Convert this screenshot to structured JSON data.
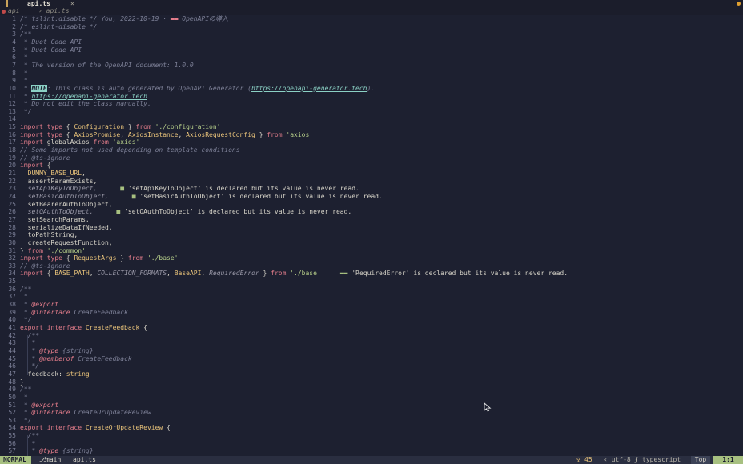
{
  "tab": {
    "label": "api.ts",
    "close": "×"
  },
  "breadcrumb": {
    "root": "api",
    "sep": "›",
    "file": "› api.ts"
  },
  "editor": {
    "lines": [
      {
        "n": "1",
        "segs": [
          [
            "cmt",
            "/* tslint:disable */ You, 2022-10-19 · "
          ],
          [
            "kw",
            "▬▬"
          ],
          [
            "cmt",
            " OpenAPIの導入"
          ]
        ]
      },
      {
        "n": "2",
        "segs": [
          [
            "cmt",
            "/* eslint-disable */"
          ]
        ]
      },
      {
        "n": "3",
        "segs": [
          [
            "cmt",
            "/**"
          ]
        ]
      },
      {
        "n": "4",
        "segs": [
          [
            "cmt",
            " * Duet Code API"
          ]
        ]
      },
      {
        "n": "5",
        "segs": [
          [
            "cmt",
            " * Duet Code API"
          ]
        ]
      },
      {
        "n": "6",
        "segs": [
          [
            "cmt",
            " *"
          ]
        ]
      },
      {
        "n": "7",
        "segs": [
          [
            "cmt",
            " * The version of the OpenAPI document: 1.0.0"
          ]
        ]
      },
      {
        "n": "8",
        "segs": [
          [
            "cmt",
            " *"
          ]
        ]
      },
      {
        "n": "9",
        "segs": [
          [
            "cmt",
            " *"
          ]
        ]
      },
      {
        "n": "10",
        "segs": [
          [
            "cmt",
            " * "
          ],
          [
            "note",
            "NOTE"
          ],
          [
            "cmt",
            ": This class is auto generated by OpenAPI Generator ("
          ],
          [
            "link",
            "https://openapi-generator.tech"
          ],
          [
            "cmt",
            ")."
          ]
        ]
      },
      {
        "n": "11",
        "segs": [
          [
            "cmt",
            " * "
          ],
          [
            "link",
            "https://openapi-generator.tech"
          ]
        ]
      },
      {
        "n": "12",
        "segs": [
          [
            "cmt",
            " * Do not edit the class manually."
          ]
        ]
      },
      {
        "n": "13",
        "segs": [
          [
            "cmt",
            " */"
          ]
        ]
      },
      {
        "n": "14",
        "segs": []
      },
      {
        "n": "15",
        "segs": [
          [
            "kw",
            "import type"
          ],
          [
            "ident",
            " { "
          ],
          [
            "type",
            "Configuration"
          ],
          [
            "ident",
            " } "
          ],
          [
            "kw",
            "from"
          ],
          [
            "str",
            " './configuration'"
          ]
        ]
      },
      {
        "n": "16",
        "segs": [
          [
            "kw",
            "import type"
          ],
          [
            "ident",
            " { "
          ],
          [
            "type",
            "AxiosPromise"
          ],
          [
            "ident",
            ", "
          ],
          [
            "type",
            "AxiosInstance"
          ],
          [
            "ident",
            ", "
          ],
          [
            "type",
            "AxiosRequestConfig"
          ],
          [
            "ident",
            " } "
          ],
          [
            "kw",
            "from"
          ],
          [
            "str",
            " 'axios'"
          ]
        ]
      },
      {
        "n": "17",
        "segs": [
          [
            "kw",
            "import"
          ],
          [
            "ident",
            " globalAxios "
          ],
          [
            "kw",
            "from"
          ],
          [
            "str",
            " 'axios'"
          ]
        ]
      },
      {
        "n": "18",
        "segs": [
          [
            "cmt",
            "// Some imports not used depending on template conditions"
          ]
        ]
      },
      {
        "n": "19",
        "segs": [
          [
            "cmt",
            "// @ts-ignore"
          ]
        ]
      },
      {
        "n": "20",
        "segs": [
          [
            "kw",
            "import"
          ],
          [
            "ident",
            " {"
          ]
        ]
      },
      {
        "n": "21",
        "segs": [
          [
            "type",
            "  DUMMY_BASE_URL"
          ],
          [
            "ident",
            ","
          ]
        ]
      },
      {
        "n": "22",
        "segs": [
          [
            "ident",
            "  assertParamExists,"
          ]
        ]
      },
      {
        "n": "23",
        "segs": [
          [
            "ital",
            "  setApiKeyToObject,"
          ],
          [
            "ident",
            "      "
          ],
          [
            "diag-mark",
            "■"
          ],
          [
            "diag",
            " 'setApiKeyToObject' is declared but its value is never read."
          ]
        ]
      },
      {
        "n": "24",
        "segs": [
          [
            "ital",
            "  setBasicAuthToObject,"
          ],
          [
            "ident",
            "      "
          ],
          [
            "diag-mark",
            "■"
          ],
          [
            "diag",
            " 'setBasicAuthToObject' is declared but its value is never read."
          ]
        ]
      },
      {
        "n": "25",
        "segs": [
          [
            "ident",
            "  setBearerAuthToObject,"
          ]
        ]
      },
      {
        "n": "26",
        "segs": [
          [
            "ital",
            "  setOAuthToObject,"
          ],
          [
            "ident",
            "      "
          ],
          [
            "diag-mark",
            "■"
          ],
          [
            "diag",
            " 'setOAuthToObject' is declared but its value is never read."
          ]
        ]
      },
      {
        "n": "27",
        "segs": [
          [
            "ident",
            "  setSearchParams,"
          ]
        ]
      },
      {
        "n": "28",
        "segs": [
          [
            "ident",
            "  serializeDataIfNeeded,"
          ]
        ]
      },
      {
        "n": "29",
        "segs": [
          [
            "ident",
            "  toPathString,"
          ]
        ]
      },
      {
        "n": "30",
        "segs": [
          [
            "ident",
            "  createRequestFunction,"
          ]
        ]
      },
      {
        "n": "31",
        "segs": [
          [
            "ident",
            "} "
          ],
          [
            "kw",
            "from"
          ],
          [
            "str",
            " './common'"
          ]
        ]
      },
      {
        "n": "32",
        "segs": [
          [
            "kw",
            "import type"
          ],
          [
            "ident",
            " { "
          ],
          [
            "type",
            "RequestArgs"
          ],
          [
            "ident",
            " } "
          ],
          [
            "kw",
            "from"
          ],
          [
            "str",
            " './base'"
          ]
        ]
      },
      {
        "n": "33",
        "segs": [
          [
            "cmt",
            "// @ts-ignore"
          ]
        ]
      },
      {
        "n": "34",
        "segs": [
          [
            "kw",
            "import"
          ],
          [
            "ident",
            " { "
          ],
          [
            "type",
            "BASE_PATH"
          ],
          [
            "ident",
            ", "
          ],
          [
            "ital",
            "COLLECTION_FORMATS"
          ],
          [
            "ident",
            ", "
          ],
          [
            "type",
            "BaseAPI"
          ],
          [
            "ident",
            ", "
          ],
          [
            "ital",
            "RequiredError"
          ],
          [
            "ident",
            " } "
          ],
          [
            "kw",
            "from"
          ],
          [
            "str",
            " './base'"
          ],
          [
            "ident",
            "     "
          ],
          [
            "diag-mark",
            "▬▬"
          ],
          [
            "diag",
            " 'RequiredError' is declared but its value is never read."
          ]
        ]
      },
      {
        "n": "35",
        "segs": []
      },
      {
        "n": "36",
        "segs": [
          [
            "cmt",
            "/**"
          ]
        ]
      },
      {
        "n": "37",
        "segs": [
          [
            "cmt",
            " *"
          ]
        ]
      },
      {
        "n": "38",
        "segs": [
          [
            "cmt",
            " * "
          ],
          [
            "tag",
            "@export"
          ]
        ]
      },
      {
        "n": "39",
        "segs": [
          [
            "cmt",
            " * "
          ],
          [
            "tag",
            "@interface"
          ],
          [
            "cmt",
            " CreateFeedback"
          ]
        ]
      },
      {
        "n": "40",
        "segs": [
          [
            "cmt",
            " */"
          ]
        ]
      },
      {
        "n": "41",
        "segs": [
          [
            "kw",
            "export interface"
          ],
          [
            "type",
            " CreateFeedback"
          ],
          [
            "ident",
            " {"
          ]
        ]
      },
      {
        "n": "42",
        "segs": [
          [
            "cmt",
            "  /**"
          ]
        ]
      },
      {
        "n": "43",
        "segs": [
          [
            "cmt",
            "   *"
          ]
        ]
      },
      {
        "n": "44",
        "segs": [
          [
            "cmt",
            "   * "
          ],
          [
            "tag",
            "@type"
          ],
          [
            "cmt",
            " {string}"
          ]
        ]
      },
      {
        "n": "45",
        "segs": [
          [
            "cmt",
            "   * "
          ],
          [
            "tag",
            "@memberof"
          ],
          [
            "cmt",
            " CreateFeedback"
          ]
        ]
      },
      {
        "n": "46",
        "segs": [
          [
            "cmt",
            "   */"
          ]
        ]
      },
      {
        "n": "47",
        "segs": [
          [
            "ident",
            "  feedback: "
          ],
          [
            "type",
            "string"
          ]
        ]
      },
      {
        "n": "48",
        "segs": [
          [
            "ident",
            "}"
          ]
        ]
      },
      {
        "n": "49",
        "segs": [
          [
            "cmt",
            "/**"
          ]
        ]
      },
      {
        "n": "50",
        "segs": [
          [
            "cmt",
            " *"
          ]
        ]
      },
      {
        "n": "51",
        "segs": [
          [
            "cmt",
            " * "
          ],
          [
            "tag",
            "@export"
          ]
        ]
      },
      {
        "n": "52",
        "segs": [
          [
            "cmt",
            " * "
          ],
          [
            "tag",
            "@interface"
          ],
          [
            "cmt",
            " CreateOrUpdateReview"
          ]
        ]
      },
      {
        "n": "53",
        "segs": [
          [
            "cmt",
            " */"
          ]
        ]
      },
      {
        "n": "54",
        "segs": [
          [
            "kw",
            "export interface"
          ],
          [
            "type",
            " CreateOrUpdateReview"
          ],
          [
            "ident",
            " {"
          ]
        ]
      },
      {
        "n": "55",
        "segs": [
          [
            "cmt",
            "  /**"
          ]
        ]
      },
      {
        "n": "56",
        "segs": [
          [
            "cmt",
            "   *"
          ]
        ]
      },
      {
        "n": "57",
        "segs": [
          [
            "cmt",
            "   * "
          ],
          [
            "tag",
            "@type"
          ],
          [
            "cmt",
            " {string}"
          ]
        ]
      }
    ]
  },
  "status": {
    "mode": "NORMAL",
    "branch_icon": "⎇",
    "branch": "main",
    "file": "api.ts",
    "warn_icon": "♀",
    "warnings": "45",
    "encoding": "‹ utf-8 ‹",
    "filetype_icon": "ʃ",
    "filetype": "typescript",
    "position": "Top",
    "location": "1:1"
  },
  "colors": {
    "background": "#1d2030",
    "keyword": "#e47d8b",
    "string": "#b7cf8a",
    "type": "#e9c37a",
    "comment": "#7d8097",
    "mode_bg": "#a7c080"
  }
}
